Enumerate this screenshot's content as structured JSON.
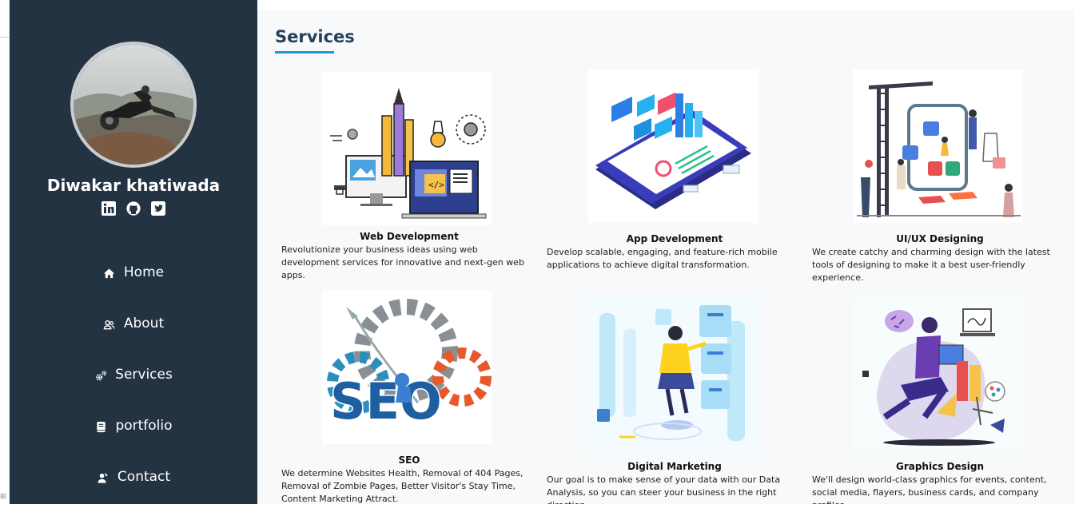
{
  "profile": {
    "name": "Diwakar khatiwada",
    "socials": [
      {
        "icon": "linkedin-icon"
      },
      {
        "icon": "github-icon"
      },
      {
        "icon": "twitter-icon"
      }
    ]
  },
  "nav": {
    "items": [
      {
        "label": "Home",
        "icon": "home-icon"
      },
      {
        "label": "About",
        "icon": "users-icon"
      },
      {
        "label": "Services",
        "icon": "gears-icon"
      },
      {
        "label": "portfolio",
        "icon": "book-icon"
      },
      {
        "label": "Contact",
        "icon": "contact-icon"
      }
    ]
  },
  "services": {
    "title": "Services",
    "cards": [
      {
        "title": "Web Development",
        "desc": "Revolutionize your business ideas using web development services for innovative and next-gen web apps."
      },
      {
        "title": "App Development",
        "desc": "Develop scalable, engaging, and feature-rich mobile applications to achieve digital transformation."
      },
      {
        "title": "UI/UX Designing",
        "desc": "We create catchy and charming design with the latest tools of designing to make it a best user-friendly experience."
      },
      {
        "title": "SEO",
        "desc": "We determine Websites Health, Removal of 404 Pages, Removal of Zombie Pages, Better Visitor's Stay Time, Content Marketing Attract."
      },
      {
        "title": "Digital Marketing",
        "desc": "Our goal is to make sense of your data with our Data Analysis, so you can steer your business in the right direction"
      },
      {
        "title": "Graphics Design",
        "desc": "We'll design world-class graphics for events, content, social media, flayers, business cards, and company profiles."
      }
    ]
  },
  "colors": {
    "sidebar_bg": "#243342",
    "accent": "#1a9ad6",
    "title": "#24415d"
  }
}
